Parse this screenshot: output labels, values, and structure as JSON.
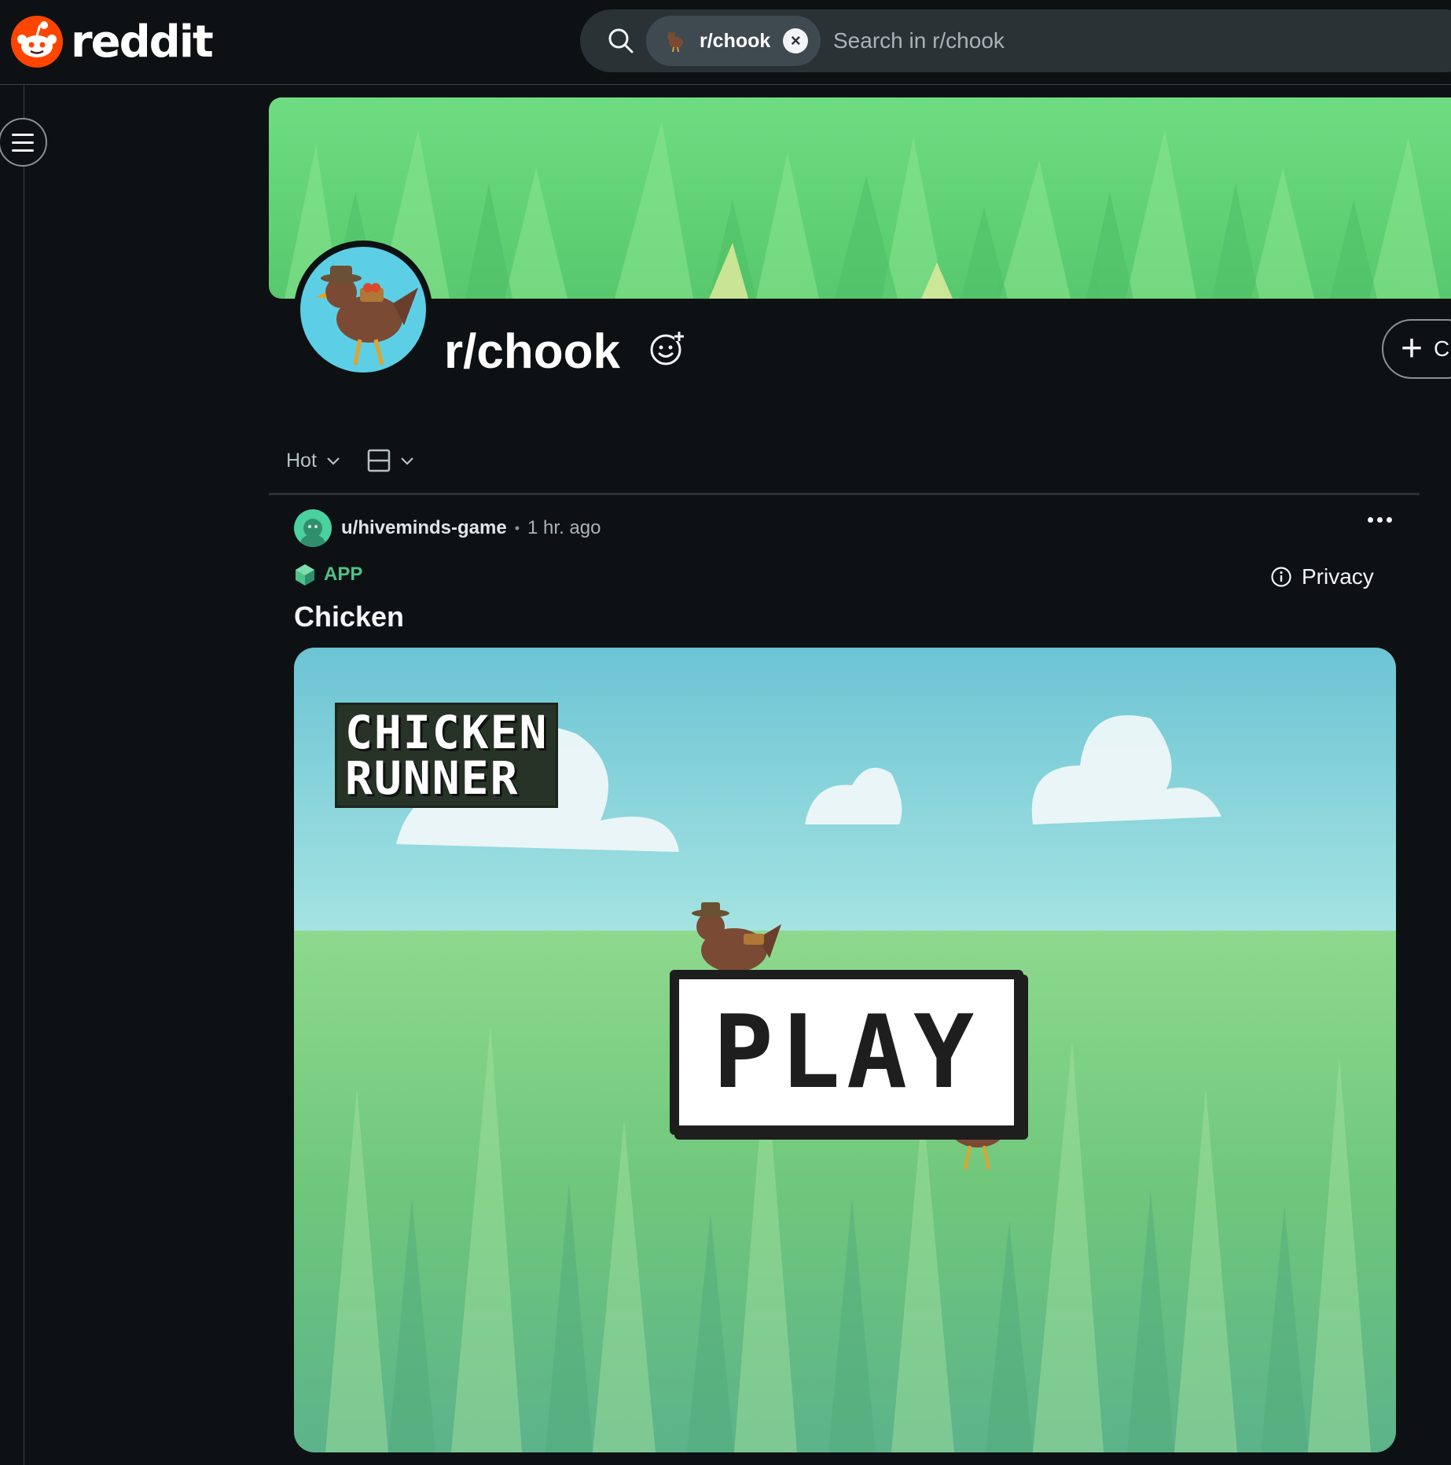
{
  "header": {
    "logo_text": "reddit",
    "search": {
      "scope_label": "r/chook",
      "placeholder": "Search in r/chook",
      "value": ""
    }
  },
  "community": {
    "name": "r/chook",
    "create_post_label": "C"
  },
  "feed": {
    "sort_label": "Hot"
  },
  "post": {
    "author": "u/hiveminds-game",
    "separator": "•",
    "time": "1 hr. ago",
    "app_label": "APP",
    "privacy_label": "Privacy",
    "title": "Chicken",
    "game": {
      "logo_line1": "CHICKEN",
      "logo_line2": "RUNNER",
      "play_label": "PLAY"
    }
  },
  "colors": {
    "background": "#0e1113",
    "brand": "#ff4500",
    "app_green": "#4fc28a",
    "banner_green": "#61d175",
    "avatar_sky": "#5ccfe6"
  },
  "icons": [
    "reddit-logo-icon",
    "search-icon",
    "close-icon",
    "menu-icon",
    "add-flair-icon",
    "plus-icon",
    "chevron-down-icon",
    "card-view-icon",
    "more-icon",
    "app-cube-icon",
    "info-icon"
  ]
}
